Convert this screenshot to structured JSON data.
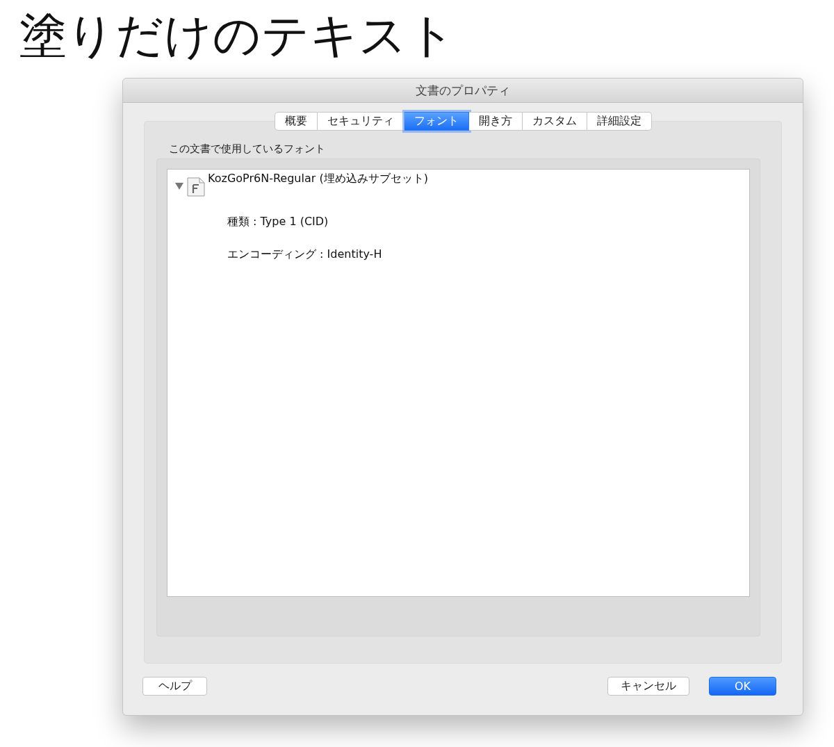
{
  "page_title": "塗りだけのテキスト",
  "dialog": {
    "title": "文書のプロパティ",
    "tabs": [
      {
        "label": "概要",
        "selected": false
      },
      {
        "label": "セキュリティ",
        "selected": false
      },
      {
        "label": "フォント",
        "selected": true
      },
      {
        "label": "開き方",
        "selected": false
      },
      {
        "label": "カスタム",
        "selected": false
      },
      {
        "label": "詳細設定",
        "selected": false
      }
    ],
    "section_label": "この文書で使用しているフォント",
    "fonts": [
      {
        "name": "KozGoPr6N-Regular (埋め込みサブセット)",
        "expanded": true,
        "details": [
          "種類 : Type 1 (CID)",
          "エンコーディング : Identity-H"
        ]
      }
    ],
    "buttons": [
      {
        "label": "ヘルプ",
        "kind": "help"
      },
      {
        "label": "キャンセル",
        "kind": "secondary"
      },
      {
        "label": "OK",
        "kind": "default"
      }
    ]
  }
}
